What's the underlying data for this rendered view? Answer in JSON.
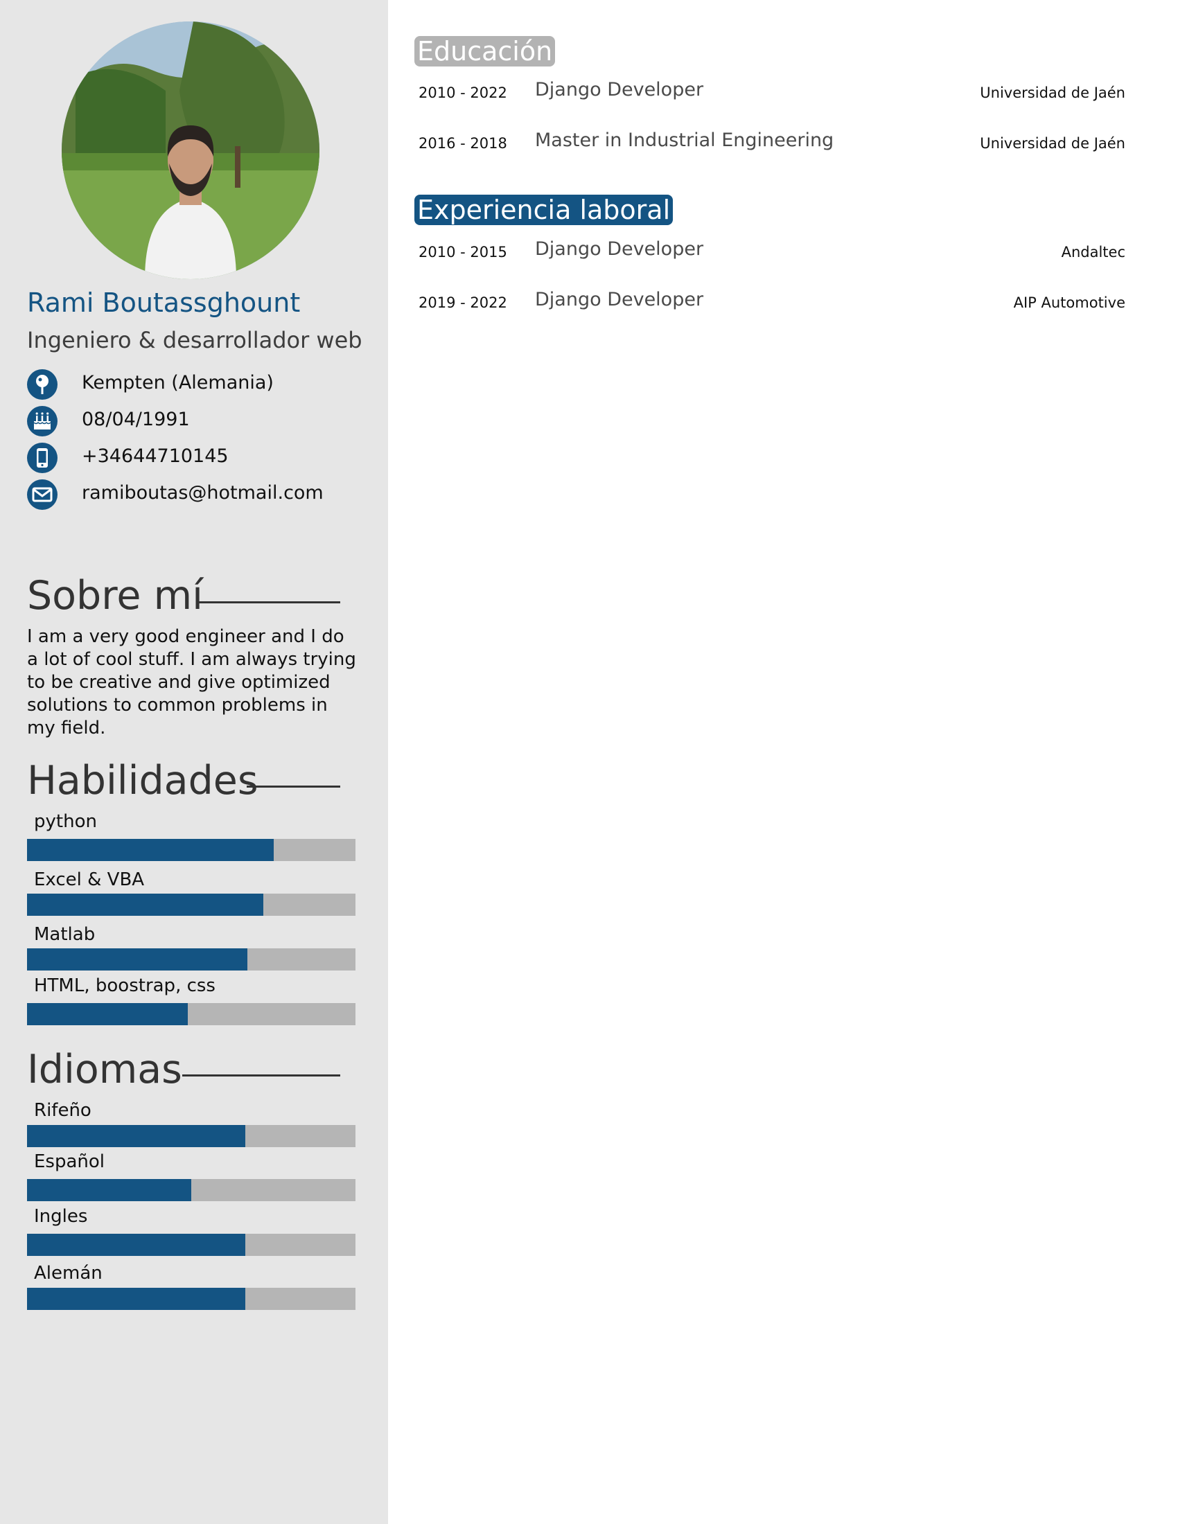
{
  "profile": {
    "name": "Rami Boutassghount",
    "role": "Ingeniero & desarrollador web",
    "photo_alt": "profile-photo"
  },
  "contact": [
    {
      "icon": "location-pin-icon",
      "text": "Kempten (Alemania)"
    },
    {
      "icon": "birthday-cake-icon",
      "text": "08/04/1991"
    },
    {
      "icon": "mobile-phone-icon",
      "text": "+34644710145"
    },
    {
      "icon": "envelope-icon",
      "text": "ramiboutas@hotmail.com"
    }
  ],
  "about": {
    "title": "Sobre mí",
    "text": "I am a very good engineer and I do a lot of cool stuff. I am always trying to be creative and give optimized solutions to common problems in my field."
  },
  "skills": {
    "title": "Habilidades",
    "items": [
      {
        "label": "python",
        "level": 0.75
      },
      {
        "label": "Excel & VBA",
        "level": 0.72
      },
      {
        "label": "Matlab",
        "level": 0.67
      },
      {
        "label": "HTML, boostrap, css",
        "level": 0.49
      }
    ]
  },
  "languages": {
    "title": "Idiomas",
    "items": [
      {
        "label": "Rifeño",
        "level": 0.665
      },
      {
        "label": "Español",
        "level": 0.5
      },
      {
        "label": "Ingles",
        "level": 0.665
      },
      {
        "label": "Alemán",
        "level": 0.665
      }
    ]
  },
  "education": {
    "title": "Educación",
    "entries": [
      {
        "years": "2010 - 2022",
        "title": "Django Developer",
        "org": "Universidad de Jaén"
      },
      {
        "years": "2016 - 2018",
        "title": "Master in Industrial Engineering",
        "org": "Universidad de Jaén"
      }
    ]
  },
  "experience": {
    "title": "Experiencia laboral",
    "entries": [
      {
        "years": "2010 - 2015",
        "title": "Django Developer",
        "org": "Andaltec"
      },
      {
        "years": "2019 - 2022",
        "title": "Django Developer",
        "org": "AIP Automotive"
      }
    ]
  },
  "colors": {
    "accent": "#145483",
    "sidebar_bg": "#e6e6e6",
    "bar_track": "#b5b5b5",
    "edu_chip": "#b3b3b3"
  }
}
